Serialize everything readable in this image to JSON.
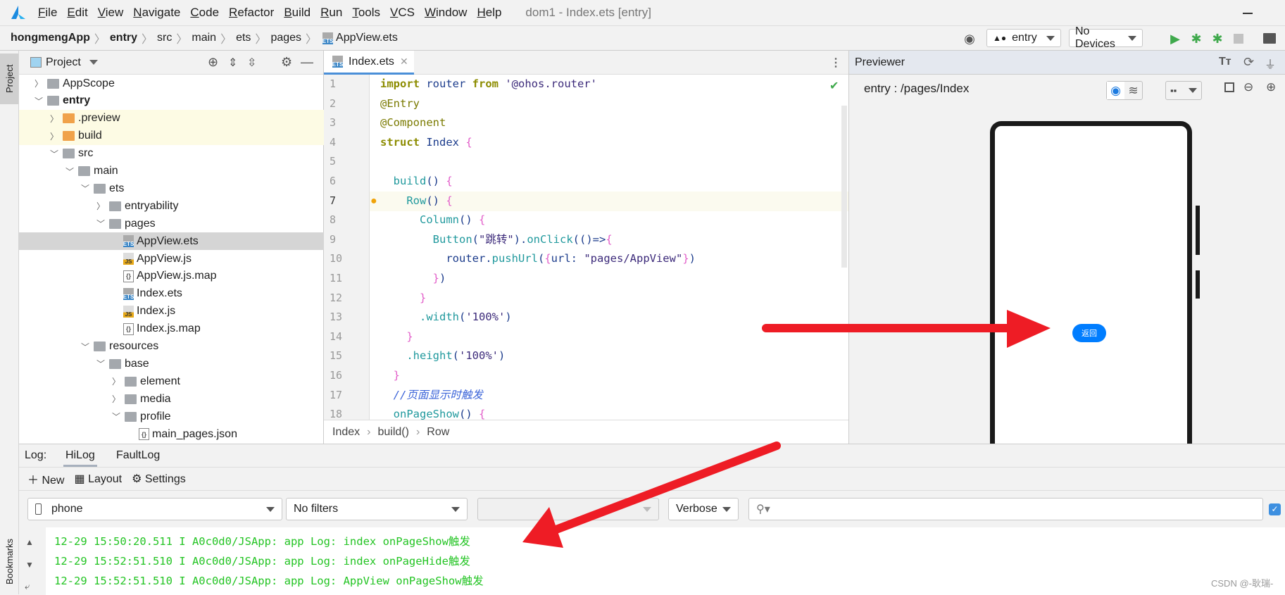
{
  "menu": {
    "items": [
      "File",
      "Edit",
      "View",
      "Navigate",
      "Code",
      "Refactor",
      "Build",
      "Run",
      "Tools",
      "VCS",
      "Window",
      "Help"
    ],
    "title": "dom1 - Index.ets [entry]"
  },
  "breadcrumb": [
    "hongmengApp",
    "entry",
    "src",
    "main",
    "ets",
    "pages",
    "AppView.ets"
  ],
  "toolbar": {
    "module": "entry",
    "device": "No Devices"
  },
  "sidebar": {
    "project_label": "Project",
    "bookmarks_label": "Bookmarks"
  },
  "project": {
    "title": "Project",
    "tree": [
      {
        "label": "AppScope",
        "depth": 0,
        "type": "folder",
        "expanded": false
      },
      {
        "label": "entry",
        "depth": 0,
        "type": "module",
        "expanded": true,
        "bold": true
      },
      {
        "label": ".preview",
        "depth": 1,
        "type": "folder-orange",
        "expanded": false,
        "highlight": true
      },
      {
        "label": "build",
        "depth": 1,
        "type": "folder-orange",
        "expanded": false,
        "highlight": true
      },
      {
        "label": "src",
        "depth": 1,
        "type": "folder",
        "expanded": true
      },
      {
        "label": "main",
        "depth": 2,
        "type": "folder",
        "expanded": true
      },
      {
        "label": "ets",
        "depth": 3,
        "type": "folder",
        "expanded": true
      },
      {
        "label": "entryability",
        "depth": 4,
        "type": "folder",
        "expanded": false
      },
      {
        "label": "pages",
        "depth": 4,
        "type": "folder",
        "expanded": true
      },
      {
        "label": "AppView.ets",
        "depth": 5,
        "type": "ets",
        "selected": true
      },
      {
        "label": "AppView.js",
        "depth": 5,
        "type": "js"
      },
      {
        "label": "AppView.js.map",
        "depth": 5,
        "type": "map"
      },
      {
        "label": "Index.ets",
        "depth": 5,
        "type": "ets"
      },
      {
        "label": "Index.js",
        "depth": 5,
        "type": "js"
      },
      {
        "label": "Index.js.map",
        "depth": 5,
        "type": "map"
      },
      {
        "label": "resources",
        "depth": 3,
        "type": "folder",
        "expanded": true
      },
      {
        "label": "base",
        "depth": 4,
        "type": "folder",
        "expanded": true
      },
      {
        "label": "element",
        "depth": 5,
        "type": "folder",
        "expanded": false
      },
      {
        "label": "media",
        "depth": 5,
        "type": "folder",
        "expanded": false
      },
      {
        "label": "profile",
        "depth": 5,
        "type": "folder",
        "expanded": true
      },
      {
        "label": "main_pages.json",
        "depth": 6,
        "type": "map"
      }
    ]
  },
  "editor": {
    "tab": "Index.ets",
    "lines": [
      [
        [
          "kw",
          "import "
        ],
        [
          "id",
          "router "
        ],
        [
          "kw",
          "from "
        ],
        [
          "str",
          "'@ohos.router'"
        ]
      ],
      [
        [
          "dec",
          "@Entry"
        ]
      ],
      [
        [
          "dec",
          "@Component"
        ]
      ],
      [
        [
          "kw",
          "struct "
        ],
        [
          "id",
          "Index "
        ],
        [
          "br",
          "{"
        ]
      ],
      [],
      [
        [
          "fn",
          "  build"
        ],
        [
          "id",
          "() "
        ],
        [
          "br",
          "{"
        ]
      ],
      [
        [
          "fn",
          "    Row"
        ],
        [
          "id",
          "() "
        ],
        [
          "br",
          "{"
        ]
      ],
      [
        [
          "fn",
          "      Column"
        ],
        [
          "id",
          "() "
        ],
        [
          "br",
          "{"
        ]
      ],
      [
        [
          "fn",
          "        Button"
        ],
        [
          "id",
          "("
        ],
        [
          "str",
          "\"跳转\""
        ],
        [
          "id",
          ")."
        ],
        [
          "fn",
          "onClick"
        ],
        [
          "id",
          "(()=>"
        ],
        [
          "br",
          "{"
        ]
      ],
      [
        [
          "id",
          "          router."
        ],
        [
          "fn",
          "pushUrl"
        ],
        [
          "id",
          "("
        ],
        [
          "br",
          "{"
        ],
        [
          "id",
          "url: "
        ],
        [
          "str",
          "\"pages/AppView\""
        ],
        [
          "br",
          "}"
        ],
        [
          "id",
          ")"
        ]
      ],
      [
        [
          "br",
          "        }"
        ],
        [
          "id",
          ")"
        ]
      ],
      [
        [
          "br",
          "      }"
        ]
      ],
      [
        [
          "fn",
          "      .width"
        ],
        [
          "id",
          "("
        ],
        [
          "str",
          "'100%'"
        ],
        [
          "id",
          ")"
        ]
      ],
      [
        [
          "br",
          "    }"
        ]
      ],
      [
        [
          "fn",
          "    .height"
        ],
        [
          "id",
          "("
        ],
        [
          "str",
          "'100%'"
        ],
        [
          "id",
          ")"
        ]
      ],
      [
        [
          "br",
          "  }"
        ]
      ],
      [
        [
          "cm",
          "  //页面显示时触发"
        ]
      ],
      [
        [
          "fn",
          "  onPageShow"
        ],
        [
          "id",
          "() "
        ],
        [
          "br",
          "{"
        ]
      ]
    ],
    "breadcrumb": [
      "Index",
      "build()",
      "Row"
    ]
  },
  "previewer": {
    "title": "Previewer",
    "path": "entry : /pages/Index",
    "button_label": "返回",
    "button_color": "#007dff"
  },
  "log": {
    "label": "Log:",
    "tabs": [
      "HiLog",
      "FaultLog"
    ],
    "actions": [
      "New",
      "Layout",
      "Settings"
    ],
    "device": "phone",
    "filter": "No filters",
    "level": "Verbose",
    "search_placeholder": "",
    "lines": [
      "12-29 15:50:20.511 I A0c0d0/JSApp: app Log: index onPageShow触发",
      "12-29 15:52:51.510 I A0c0d0/JSApp: app Log: index onPageHide触发",
      "12-29 15:52:51.510 I A0c0d0/JSApp: app Log: AppView onPageShow触发"
    ]
  },
  "watermark": "CSDN @-耿瑞-",
  "colors": {
    "arrow": "#ee1c25",
    "log_text": "#23c423",
    "accent": "#4a8fd8"
  }
}
